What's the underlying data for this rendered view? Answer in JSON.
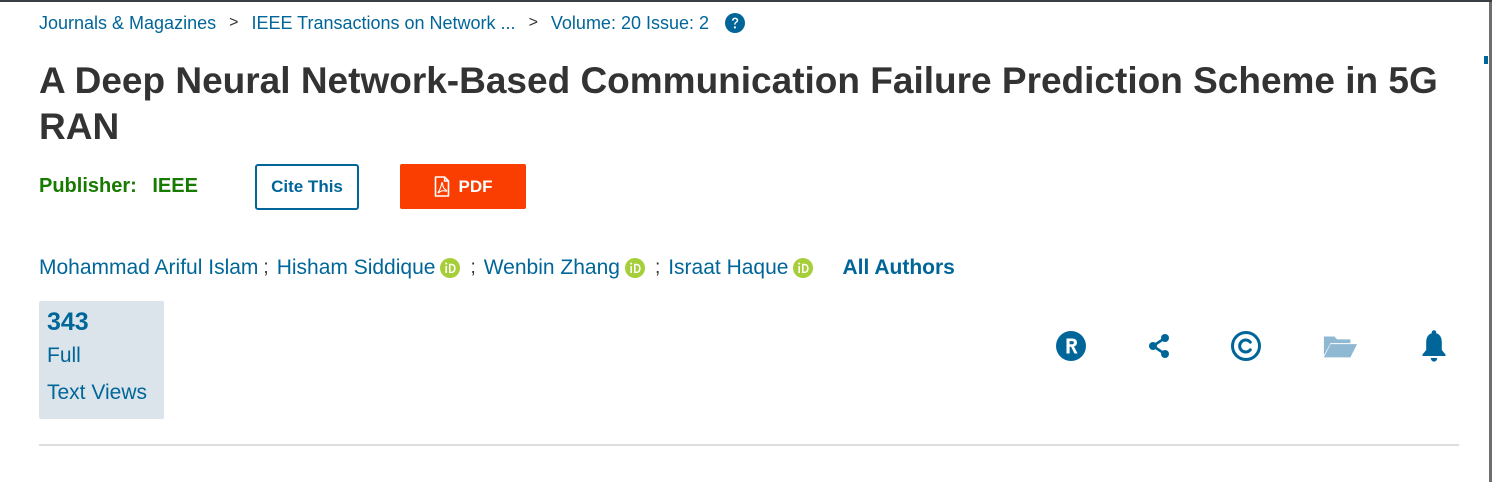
{
  "breadcrumb": {
    "items": [
      "Journals & Magazines",
      "IEEE Transactions on Network ...",
      "Volume: 20 Issue: 2"
    ],
    "separator": ">"
  },
  "article": {
    "title": "A Deep Neural Network-Based Communication Failure Prediction Scheme in 5G RAN",
    "publisher_label": "Publisher:",
    "publisher_name": "IEEE"
  },
  "actions": {
    "cite_label": "Cite This",
    "pdf_label": "PDF"
  },
  "authors": {
    "list": [
      {
        "name": "Mohammad Ariful Islam",
        "orcid": false
      },
      {
        "name": "Hisham Siddique",
        "orcid": true
      },
      {
        "name": "Wenbin Zhang",
        "orcid": true
      },
      {
        "name": "Israat Haque",
        "orcid": true
      }
    ],
    "separator": ";",
    "all_label": "All Authors"
  },
  "metrics": {
    "count": "343",
    "label_line1": "Full",
    "label_line2": "Text Views"
  },
  "toolbar": {
    "icons": [
      "rights-icon",
      "share-icon",
      "copyright-icon",
      "folder-icon",
      "alert-bell-icon"
    ]
  },
  "colors": {
    "link": "#006699",
    "publisher": "#177b00",
    "pdf_button": "#fa3d00",
    "orcid": "#a6ce39",
    "metric_bg": "#dbe4ea",
    "folder_icon": "#8fb8d3"
  }
}
